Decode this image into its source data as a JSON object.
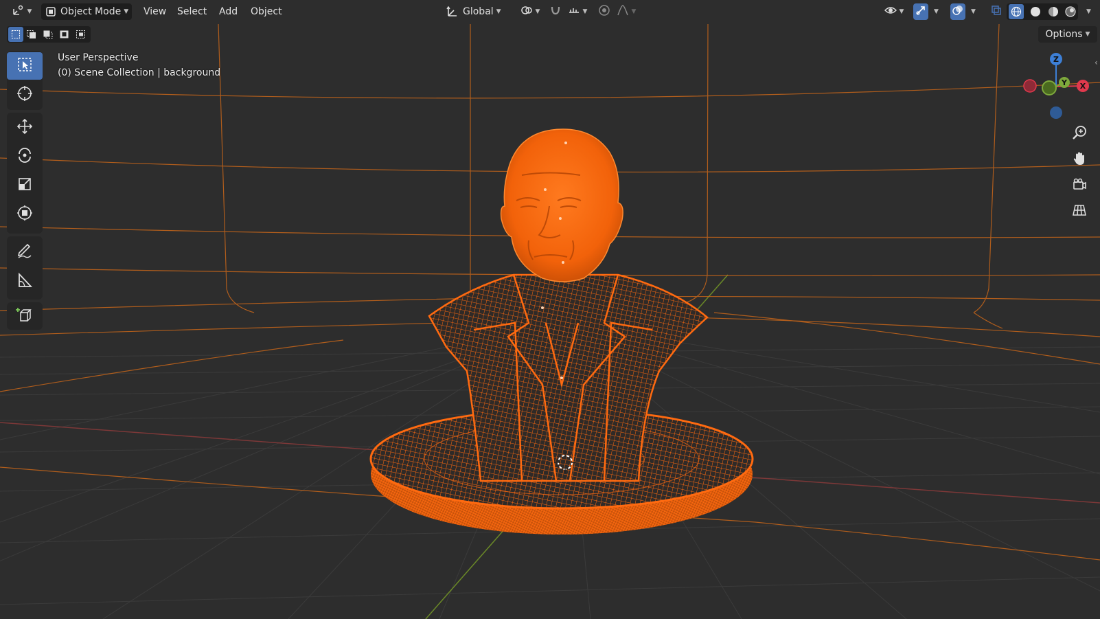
{
  "header": {
    "editor_icon": "editor-type-icon",
    "mode": {
      "label": "Object Mode",
      "icon": "object-mode-icon"
    },
    "menus": [
      "View",
      "Select",
      "Add",
      "Object"
    ],
    "transform_orientation": {
      "label": "Global",
      "icon": "orientation-axes-icon"
    },
    "pivot_icon": "pivot-point-icon",
    "snap_icon": "snap-magnet-icon",
    "snap_target_icon": "snap-increment-icon",
    "proportional_icon": "proportional-editing-icon",
    "falloff_icon": "falloff-curve-icon",
    "right_icons": [
      "visibility-eye-icon",
      "gizmo-toggle-icon",
      "overlays-icon",
      "xray-toggle-icon",
      "shading-wireframe-icon",
      "shading-solid-icon",
      "shading-material-icon",
      "shading-rendered-icon"
    ]
  },
  "select_modes": [
    "select-new-icon",
    "select-extend-icon",
    "select-subtract-icon",
    "select-invert-icon",
    "select-intersect-icon"
  ],
  "options_label": "Options",
  "overlay": {
    "view_name": "User Perspective",
    "collection": "(0) Scene Collection | background"
  },
  "tools": [
    {
      "name": "select-box-tool",
      "icon": "select-cursor-icon",
      "active": true
    },
    {
      "name": "cursor-tool",
      "icon": "3d-cursor-icon",
      "active": false
    },
    {
      "name": "move-tool",
      "icon": "move-arrows-icon",
      "active": false
    },
    {
      "name": "rotate-tool",
      "icon": "rotate-icon",
      "active": false
    },
    {
      "name": "scale-tool",
      "icon": "scale-icon",
      "active": false
    },
    {
      "name": "transform-tool",
      "icon": "transform-icon",
      "active": false
    },
    {
      "name": "annotate-tool",
      "icon": "annotate-pencil-icon",
      "active": false
    },
    {
      "name": "measure-tool",
      "icon": "measure-ruler-icon",
      "active": false
    },
    {
      "name": "add-cube-tool",
      "icon": "add-cube-icon",
      "active": false
    }
  ],
  "gizmo": {
    "z_label": "Z",
    "y_label": "Y",
    "x_label": "X",
    "x_color": "#e0394d",
    "y_color": "#7ea93c",
    "z_color": "#3d7fd6"
  },
  "nav_buttons": [
    "zoom-magnifier-icon",
    "pan-hand-icon",
    "camera-view-icon",
    "ortho-grid-icon"
  ],
  "colors": {
    "background": "#2b2b2b",
    "grid": "#3a3a3a",
    "selection_wire": "#ff6a10",
    "active_tool": "#4772b3",
    "x_axis_line": "#8a3a3a",
    "y_axis_line": "#6d8a2a"
  }
}
